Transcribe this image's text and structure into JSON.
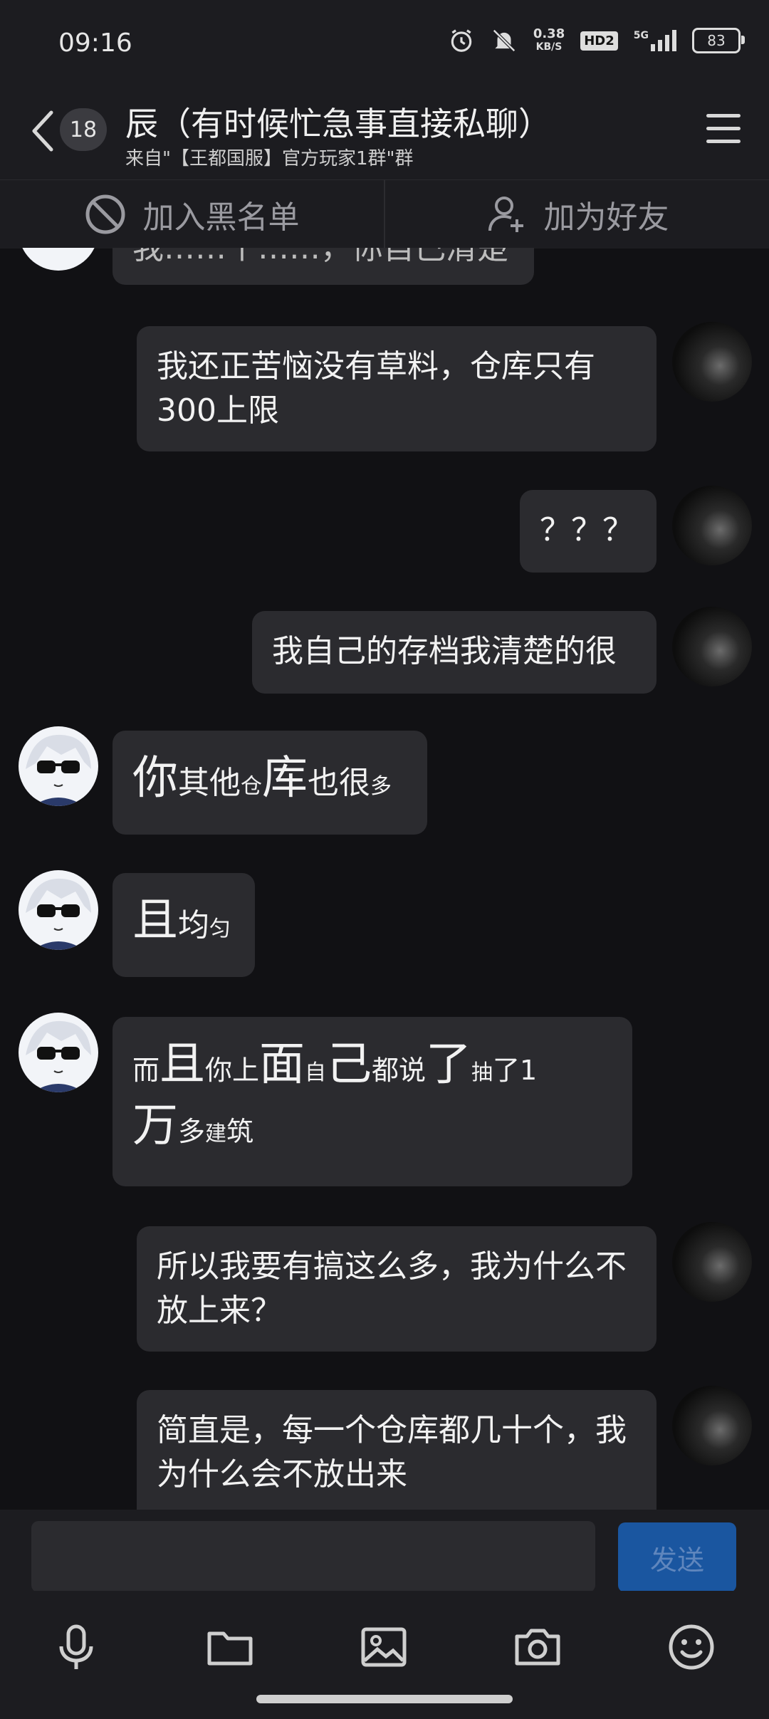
{
  "status_bar": {
    "time": "09:16",
    "net_speed_value": "0.38",
    "net_speed_unit": "KB/S",
    "hd_label": "HD2",
    "signal_label": "5G",
    "battery": "83"
  },
  "header": {
    "unread_count": "18",
    "title": "辰（有时候忙急事直接私聊）",
    "subtitle": "来自\"【王都国服】官方玩家1群\"群"
  },
  "actions": {
    "blacklist": "加入黑名单",
    "add_friend": "加为好友"
  },
  "messages": {
    "m0": "我……个……，你自己清楚",
    "m1": "我还正苦恼没有草料，仓库只有300上限",
    "m2": "？？？",
    "m3": "我自己的存档我清楚的很",
    "m4": [
      "你",
      "其他",
      "仓",
      "库",
      "也很",
      "多"
    ],
    "m5": [
      "且",
      "均",
      "匀"
    ],
    "m6": [
      "而",
      "且",
      "你上",
      "面",
      "自",
      "己",
      "都说",
      "了",
      "抽",
      "了1",
      "万",
      "多",
      "建",
      "筑"
    ],
    "m7": "所以我要有搞这么多，我为什么不放上来？",
    "m8": "简直是，每一个仓库都几十个，我为什么会不放出来"
  },
  "input": {
    "send_label": "发送"
  }
}
